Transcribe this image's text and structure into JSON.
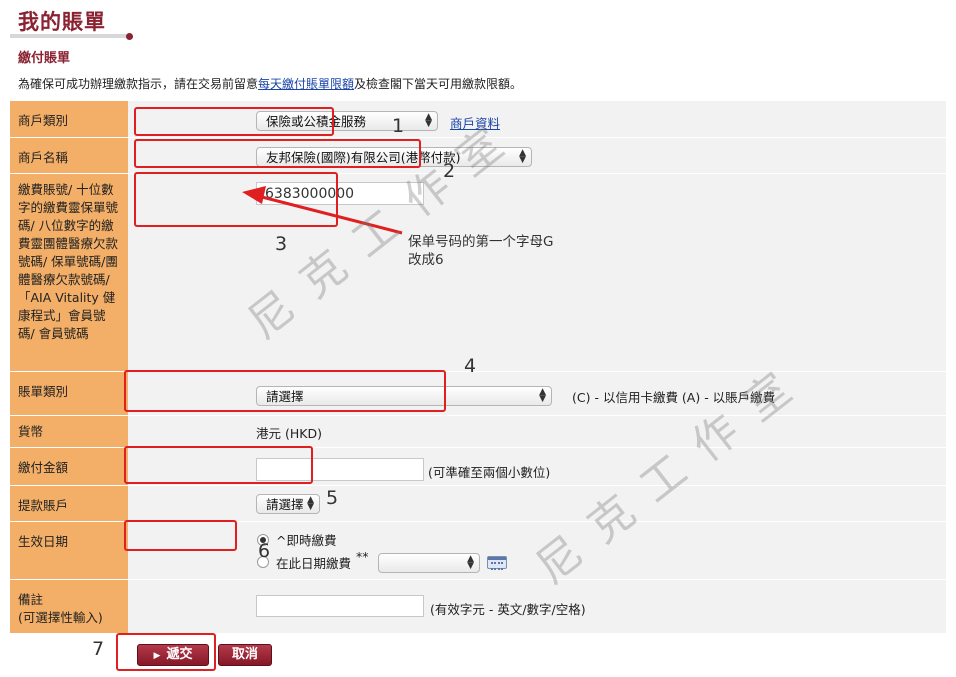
{
  "header": {
    "title": "我的賬單",
    "section": "繳付賬單"
  },
  "intro": {
    "before": "為確保可成功辦理繳款指示，請在交易前留意",
    "link": "每天繳付賬單限額",
    "after": "及檢查閣下當天可用繳款限額。"
  },
  "rows": {
    "merchant_category": {
      "label": "商戶類別",
      "value": "保險或公積金服務",
      "link": "商戶資料"
    },
    "merchant_name": {
      "label": "商戶名稱",
      "value": "友邦保險(國際)有限公司(港幣付款)"
    },
    "account_number": {
      "label": "繳費賬號/ 十位數字的繳費靈保單號碼/ 八位數字的繳費靈團體醫療欠款號碼/ 保單號碼/團體醫療欠款號碼/ 「AIA Vitality 健康程式」會員號碼/ 會員號碼",
      "value": "6383000000"
    },
    "bill_type": {
      "label": "賬單類別",
      "value": "請選擇",
      "hint": "(C) - 以信用卡繳費   (A) - 以賬戶繳費"
    },
    "currency": {
      "label": "貨幣",
      "value": "港元 (HKD)"
    },
    "amount": {
      "label": "繳付金額",
      "value": "",
      "hint": "(可準確至兩個小數位)"
    },
    "debit_account": {
      "label": "提款賬戶",
      "value": "請選擇"
    },
    "effective_date": {
      "label": "生效日期",
      "option_now": "^即時繳費",
      "option_date": "在此日期繳費",
      "option_date_mark": "**",
      "date_value": ""
    },
    "remarks": {
      "label": "備註\n(可選擇性輸入)",
      "value": "",
      "hint": "(有效字元 - 英文/數字/空格)"
    }
  },
  "buttons": {
    "submit": "遞交",
    "cancel": "取消"
  },
  "annotations": {
    "numbers": [
      "1",
      "2",
      "3",
      "4",
      "5",
      "6",
      "7"
    ],
    "note_line1": "保单号码的第一个字母G",
    "note_line2": "改成6",
    "highlight_color": "#e02020"
  },
  "watermark": {
    "text": "尼克工作室"
  },
  "colors": {
    "label_bg": "#f3ae67",
    "title": "#8a2231",
    "link": "#1a44a8",
    "button": "#861827"
  }
}
